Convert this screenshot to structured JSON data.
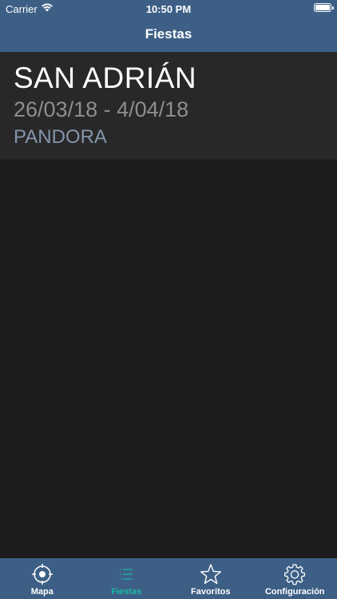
{
  "status_bar": {
    "carrier": "Carrier",
    "time": "10:50 PM",
    "wifi_icon": "wifi-icon",
    "battery_icon": "battery-icon"
  },
  "header": {
    "title": "Fiestas"
  },
  "fiestas": [
    {
      "name": "SAN ADRIÁN",
      "dates": "26/03/18 - 4/04/18",
      "place": "PANDORA"
    }
  ],
  "tab_bar": {
    "tabs": [
      {
        "label": "Mapa",
        "icon": "map-target-icon",
        "active": false
      },
      {
        "label": "Fiestas",
        "icon": "list-icon",
        "active": true
      },
      {
        "label": "Favoritos",
        "icon": "star-icon",
        "active": false
      },
      {
        "label": "Configuración",
        "icon": "gear-icon",
        "active": false
      }
    ]
  },
  "colors": {
    "bar_background": "#3d5f86",
    "screen_background": "#1c1c1c",
    "row_background": "#282828",
    "active_tab": "#19b7a6",
    "dates_text": "#8e8e8e",
    "place_text": "#8496ab"
  }
}
